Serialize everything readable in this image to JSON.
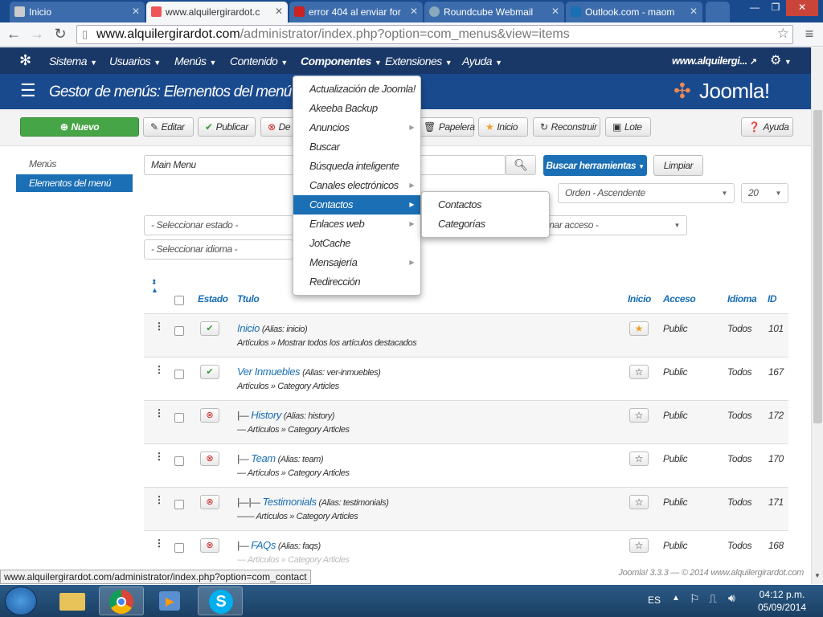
{
  "browser": {
    "tabs": [
      {
        "title": "Inicio",
        "active": false
      },
      {
        "title": "www.alquilergirardot.c",
        "active": true
      },
      {
        "title": "error 404 al enviar for",
        "active": false
      },
      {
        "title": "Roundcube Webmail",
        "active": false
      },
      {
        "title": "Outlook.com - maom",
        "active": false
      }
    ],
    "url_host": "www.alquilergirardot.com",
    "url_path": "/administrator/index.php?option=com_menus&view=items",
    "status_url": "www.alquilergirardot.com/administrator/index.php?option=com_contact"
  },
  "nav": {
    "items": [
      "Sistema",
      "Usuarios",
      "Menús",
      "Contenido",
      "Componentes",
      "Extensiones",
      "Ayuda"
    ],
    "site_link": "www.alquilergi..."
  },
  "header": {
    "title": "Gestor de menús: Elementos del menú",
    "logo_text": "Joomla!"
  },
  "toolbar": {
    "new": "Nuevo",
    "edit": "Editar",
    "publish": "Publicar",
    "unpublish": "De",
    "trash": "Papelera",
    "home": "Inicio",
    "rebuild": "Reconstruir",
    "batch": "Lote",
    "help": "Ayuda"
  },
  "sidebar": {
    "items": [
      "Menús",
      "Elementos del menú"
    ]
  },
  "filters": {
    "menu": "Main Menu",
    "search_tools": "Buscar herramientas",
    "clear": "Limpiar",
    "order": "Orden - Ascendente",
    "limit": "20",
    "state": "- Seleccionar estado -",
    "access": "onar acceso -",
    "language": "- Seleccionar idioma -"
  },
  "table": {
    "headers": {
      "status": "Estado",
      "title": "Ttulo",
      "home": "Inicio",
      "access": "Acceso",
      "language": "Idioma",
      "id": "ID"
    },
    "rows": [
      {
        "prefix": "",
        "title": "Inicio",
        "alias": "(Alias: inicio)",
        "sub": "Artículos » Mostrar todos los artículos destacados",
        "published": true,
        "home": true,
        "access": "Public",
        "language": "Todos",
        "id": "101"
      },
      {
        "prefix": "",
        "title": "Ver Inmuebles",
        "alias": "(Alias: ver-inmuebles)",
        "sub": "Artículos » Category Articles",
        "published": true,
        "home": false,
        "access": "Public",
        "language": "Todos",
        "id": "167"
      },
      {
        "prefix": "|— ",
        "title": "History",
        "alias": "(Alias: history)",
        "sub": "— Artículos » Category Articles",
        "published": false,
        "home": false,
        "access": "Public",
        "language": "Todos",
        "id": "172"
      },
      {
        "prefix": "|— ",
        "title": "Team",
        "alias": "(Alias: team)",
        "sub": "— Artículos » Category Articles",
        "published": false,
        "home": false,
        "access": "Public",
        "language": "Todos",
        "id": "170"
      },
      {
        "prefix": "|—|— ",
        "title": "Testimonials",
        "alias": "(Alias: testimonials)",
        "sub": "—— Artículos » Category Articles",
        "published": false,
        "home": false,
        "access": "Public",
        "language": "Todos",
        "id": "171"
      },
      {
        "prefix": "|— ",
        "title": "FAQs",
        "alias": "(Alias: faqs)",
        "sub": "— Artículos » Category Articles",
        "published": false,
        "home": false,
        "access": "Public",
        "language": "Todos",
        "id": "168"
      }
    ]
  },
  "components_menu": {
    "items": [
      "Actualización de Joomla!",
      "Akeeba Backup",
      "Anuncios",
      "Buscar",
      "Búsqueda inteligente",
      "Canales electrónicos",
      "Contactos",
      "Enlaces web",
      "JotCache",
      "Mensajería",
      "Redirección"
    ],
    "submenu": [
      "Contactos",
      "Categorías"
    ]
  },
  "footer": {
    "text": "Joomla! 3.3.3 — © 2014 www.alquilergirardot.com"
  },
  "taskbar": {
    "lang": "ES",
    "time": "04:12 p.m.",
    "date": "05/09/2014"
  },
  "colors": {
    "nav_bg": "#1a3867",
    "header_bg": "#1a4a8e",
    "accent": "#1a6fb5",
    "new_btn": "#46a546"
  }
}
